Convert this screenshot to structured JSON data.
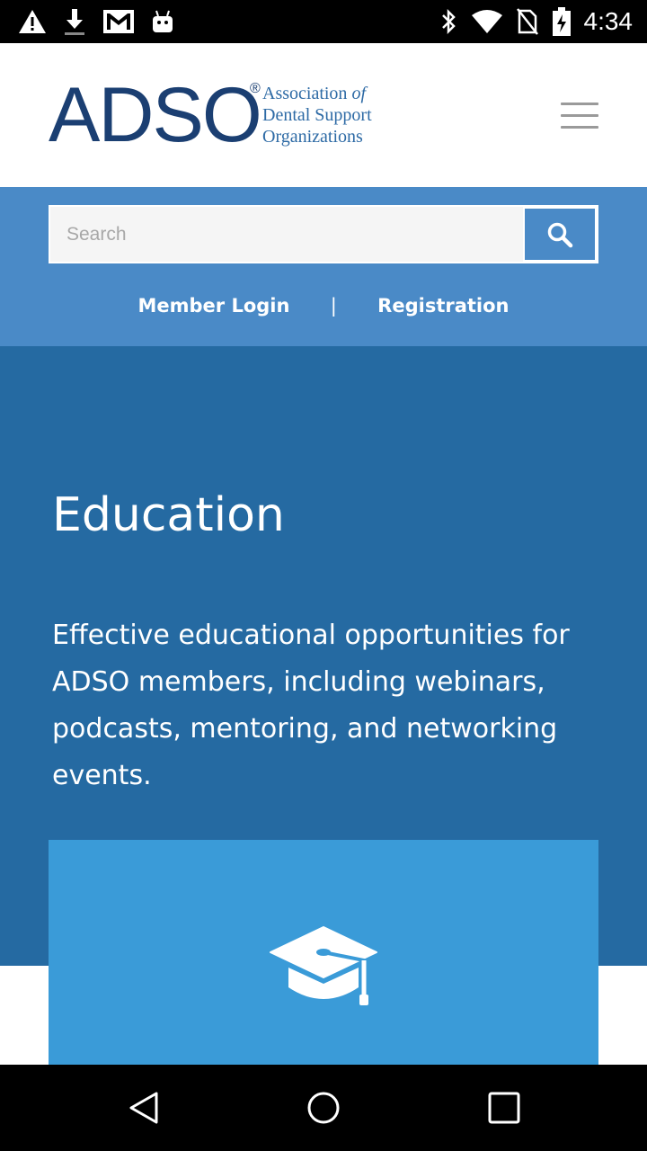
{
  "status_bar": {
    "time": "4:34",
    "icons_left": [
      "warning-icon",
      "download-icon",
      "gmail-icon",
      "android-icon"
    ],
    "icons_right": [
      "bluetooth-icon",
      "wifi-icon",
      "no-sim-icon",
      "battery-charging-icon"
    ]
  },
  "header": {
    "logo": {
      "mark": "ADSO",
      "registered": "®",
      "line1": "Association",
      "line1_suffix": "of",
      "line2": "Dental Support",
      "line3": "Organizations"
    },
    "menu_icon": "hamburger-menu-icon"
  },
  "search": {
    "placeholder": "Search",
    "value": "",
    "button_icon": "search-icon"
  },
  "account_links": {
    "login": "Member Login",
    "separator": "|",
    "register": "Registration"
  },
  "hero": {
    "title": "Education",
    "description": "Effective educational opportunities for ADSO members, including webinars, podcasts, mentoring, and networking events."
  },
  "card": {
    "icon": "graduation-cap-icon"
  },
  "nav_bar": {
    "buttons": [
      "back-icon",
      "home-icon",
      "recents-icon"
    ]
  },
  "colors": {
    "brand_navy": "#1b3f72",
    "search_band": "#4a8ac7",
    "hero_bg": "#256aa2",
    "card_bg": "#3a9bd8"
  }
}
